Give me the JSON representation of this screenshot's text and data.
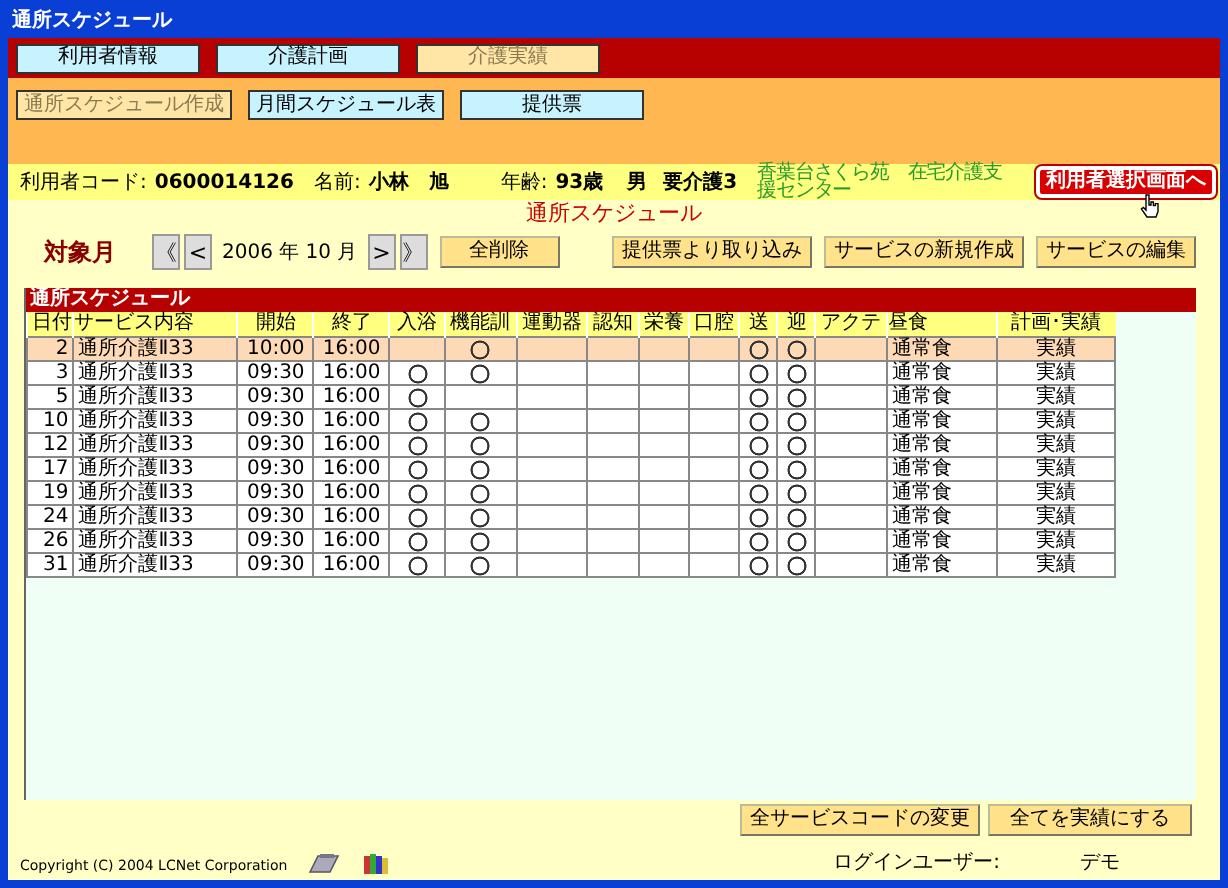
{
  "window": {
    "title": "通所スケジュール"
  },
  "nav_tabs": [
    {
      "label": "利用者情報",
      "selected": false
    },
    {
      "label": "介護計画",
      "selected": false
    },
    {
      "label": "介護実績",
      "selected": true
    }
  ],
  "sub_tabs": [
    {
      "label": "通所スケジュール作成",
      "selected": true
    },
    {
      "label": "月間スケジュール表",
      "selected": false
    },
    {
      "label": "提供票",
      "selected": false
    }
  ],
  "user_info": {
    "code_label": "利用者コード:",
    "code": "0600014126",
    "name_label": "名前:",
    "name": "小林　旭",
    "age_label": "年齢:",
    "age": "93歳",
    "sex": "男",
    "care_level": "要介護3",
    "facility": "香葉台さくら苑　在宅介護支援センター",
    "back_button": "利用者選択画面へ"
  },
  "heading": "通所スケジュール",
  "month_bar": {
    "label": "対象月",
    "first_button": "《",
    "prev_button": "<",
    "month": "2006 年 10 月",
    "next_button": ">",
    "last_button": "》",
    "clear_button": "全削除",
    "actions": [
      "提供票より取り込み",
      "サービスの新規作成",
      "サービスの編集"
    ]
  },
  "schedule": {
    "title": "通所スケジュール",
    "columns": [
      {
        "label": "日付",
        "kind": "num"
      },
      {
        "label": "サービス内容",
        "kind": "text"
      },
      {
        "label": "開始",
        "kind": "center"
      },
      {
        "label": "終了",
        "kind": "center"
      },
      {
        "label": "入浴",
        "kind": "mark"
      },
      {
        "label": "機能訓",
        "kind": "mark"
      },
      {
        "label": "運動器",
        "kind": "mark"
      },
      {
        "label": "認知",
        "kind": "mark"
      },
      {
        "label": "栄養",
        "kind": "mark"
      },
      {
        "label": "口腔",
        "kind": "mark"
      },
      {
        "label": "送",
        "kind": "mark"
      },
      {
        "label": "迎",
        "kind": "mark"
      },
      {
        "label": "アクテ",
        "kind": "mark"
      },
      {
        "label": "昼食",
        "kind": "text"
      },
      {
        "label": "計画･実績",
        "kind": "center"
      }
    ],
    "rows": [
      {
        "selected": true,
        "cells": [
          "2",
          "通所介護Ⅱ33",
          "10:00",
          "16:00",
          false,
          true,
          false,
          false,
          false,
          false,
          true,
          true,
          false,
          "通常食",
          "実績"
        ]
      },
      {
        "selected": false,
        "cells": [
          "3",
          "通所介護Ⅱ33",
          "09:30",
          "16:00",
          true,
          true,
          false,
          false,
          false,
          false,
          true,
          true,
          false,
          "通常食",
          "実績"
        ]
      },
      {
        "selected": false,
        "cells": [
          "5",
          "通所介護Ⅱ33",
          "09:30",
          "16:00",
          true,
          false,
          false,
          false,
          false,
          false,
          true,
          true,
          false,
          "通常食",
          "実績"
        ]
      },
      {
        "selected": false,
        "cells": [
          "10",
          "通所介護Ⅱ33",
          "09:30",
          "16:00",
          true,
          true,
          false,
          false,
          false,
          false,
          true,
          true,
          false,
          "通常食",
          "実績"
        ]
      },
      {
        "selected": false,
        "cells": [
          "12",
          "通所介護Ⅱ33",
          "09:30",
          "16:00",
          true,
          true,
          false,
          false,
          false,
          false,
          true,
          true,
          false,
          "通常食",
          "実績"
        ]
      },
      {
        "selected": false,
        "cells": [
          "17",
          "通所介護Ⅱ33",
          "09:30",
          "16:00",
          true,
          true,
          false,
          false,
          false,
          false,
          true,
          true,
          false,
          "通常食",
          "実績"
        ]
      },
      {
        "selected": false,
        "cells": [
          "19",
          "通所介護Ⅱ33",
          "09:30",
          "16:00",
          true,
          true,
          false,
          false,
          false,
          false,
          true,
          true,
          false,
          "通常食",
          "実績"
        ]
      },
      {
        "selected": false,
        "cells": [
          "24",
          "通所介護Ⅱ33",
          "09:30",
          "16:00",
          true,
          true,
          false,
          false,
          false,
          false,
          true,
          true,
          false,
          "通常食",
          "実績"
        ]
      },
      {
        "selected": false,
        "cells": [
          "26",
          "通所介護Ⅱ33",
          "09:30",
          "16:00",
          true,
          true,
          false,
          false,
          false,
          false,
          true,
          true,
          false,
          "通常食",
          "実績"
        ]
      },
      {
        "selected": false,
        "cells": [
          "31",
          "通所介護Ⅱ33",
          "09:30",
          "16:00",
          true,
          true,
          false,
          false,
          false,
          false,
          true,
          true,
          false,
          "通常食",
          "実績"
        ]
      }
    ]
  },
  "bottom_buttons": [
    "全サービスコードの変更",
    "全てを実績にする"
  ],
  "footer": {
    "copyright": "Copyright (C) 2004 LCNet Corporation",
    "login_label": "ログインユーザー:",
    "login_user": "デモ"
  }
}
